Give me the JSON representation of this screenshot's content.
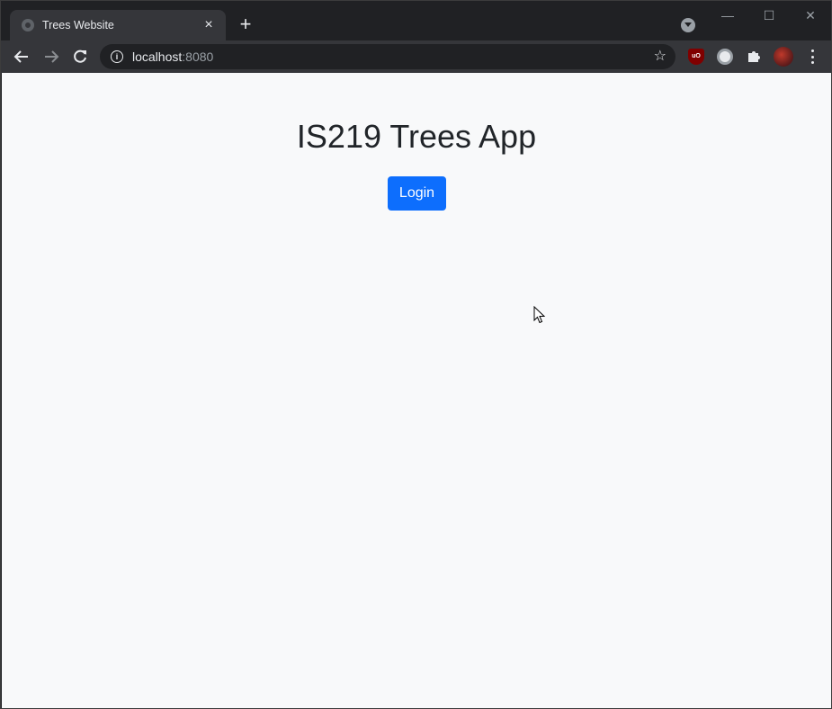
{
  "browser": {
    "tab": {
      "title": "Trees Website",
      "close_glyph": "×"
    },
    "new_tab_glyph": "+",
    "window_controls": {
      "minimize": "—",
      "maximize": "☐",
      "close": "✕"
    },
    "address": {
      "host": "localhost",
      "port": ":8080"
    },
    "bookmark_glyph": "☆",
    "extensions": [
      {
        "name": "ublock-icon",
        "text": "uO"
      },
      {
        "name": "circle-extension-icon"
      },
      {
        "name": "extensions-puzzle-icon"
      }
    ]
  },
  "page": {
    "heading": "IS219 Trees App",
    "login_label": "Login"
  },
  "colors": {
    "accent": "#0d6efd",
    "page_bg": "#f8f9fa",
    "chrome_dark": "#202124",
    "chrome_toolbar": "#35363a"
  }
}
